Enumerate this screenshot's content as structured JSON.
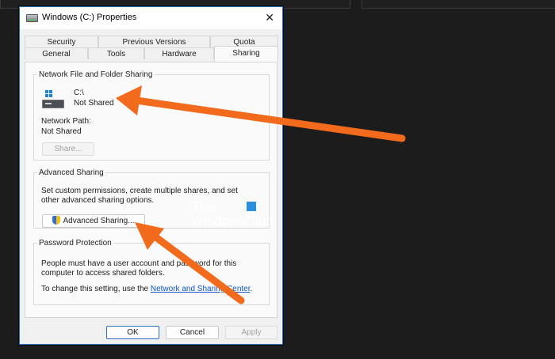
{
  "window": {
    "title": "Windows (C:) Properties",
    "close_glyph": "✕"
  },
  "tabs": {
    "row1": [
      "Security",
      "Previous Versions",
      "Quota"
    ],
    "row2": [
      "General",
      "Tools",
      "Hardware",
      "Sharing"
    ],
    "active": "Sharing"
  },
  "network_sharing": {
    "group_label": "Network File and Folder Sharing",
    "drive": "C:\\",
    "status": "Not Shared",
    "path_label": "Network Path:",
    "path_value": "Not Shared",
    "share_button": "Share..."
  },
  "advanced_sharing": {
    "group_label": "Advanced Sharing",
    "description": "Set custom permissions, create multiple shares, and set other advanced sharing options.",
    "button": "Advanced Sharing..."
  },
  "password_protection": {
    "group_label": "Password Protection",
    "description": "People must have a user account and password for this computer to access shared folders.",
    "setting_prefix": "To change this setting, use the ",
    "link_text": "Network and Sharing Center",
    "setting_suffix": "."
  },
  "footer": {
    "ok": "OK",
    "cancel": "Cancel",
    "apply": "Apply"
  },
  "watermark": {
    "line1": "The",
    "line2": "WindowsClub"
  },
  "colors": {
    "accent": "#2b6fc4",
    "arrow": "#f26a1b",
    "link": "#0f56c2",
    "background": "#1c1c1c"
  },
  "icons": [
    "drive-icon",
    "windows-logo-icon",
    "uac-shield-icon",
    "close-icon"
  ]
}
